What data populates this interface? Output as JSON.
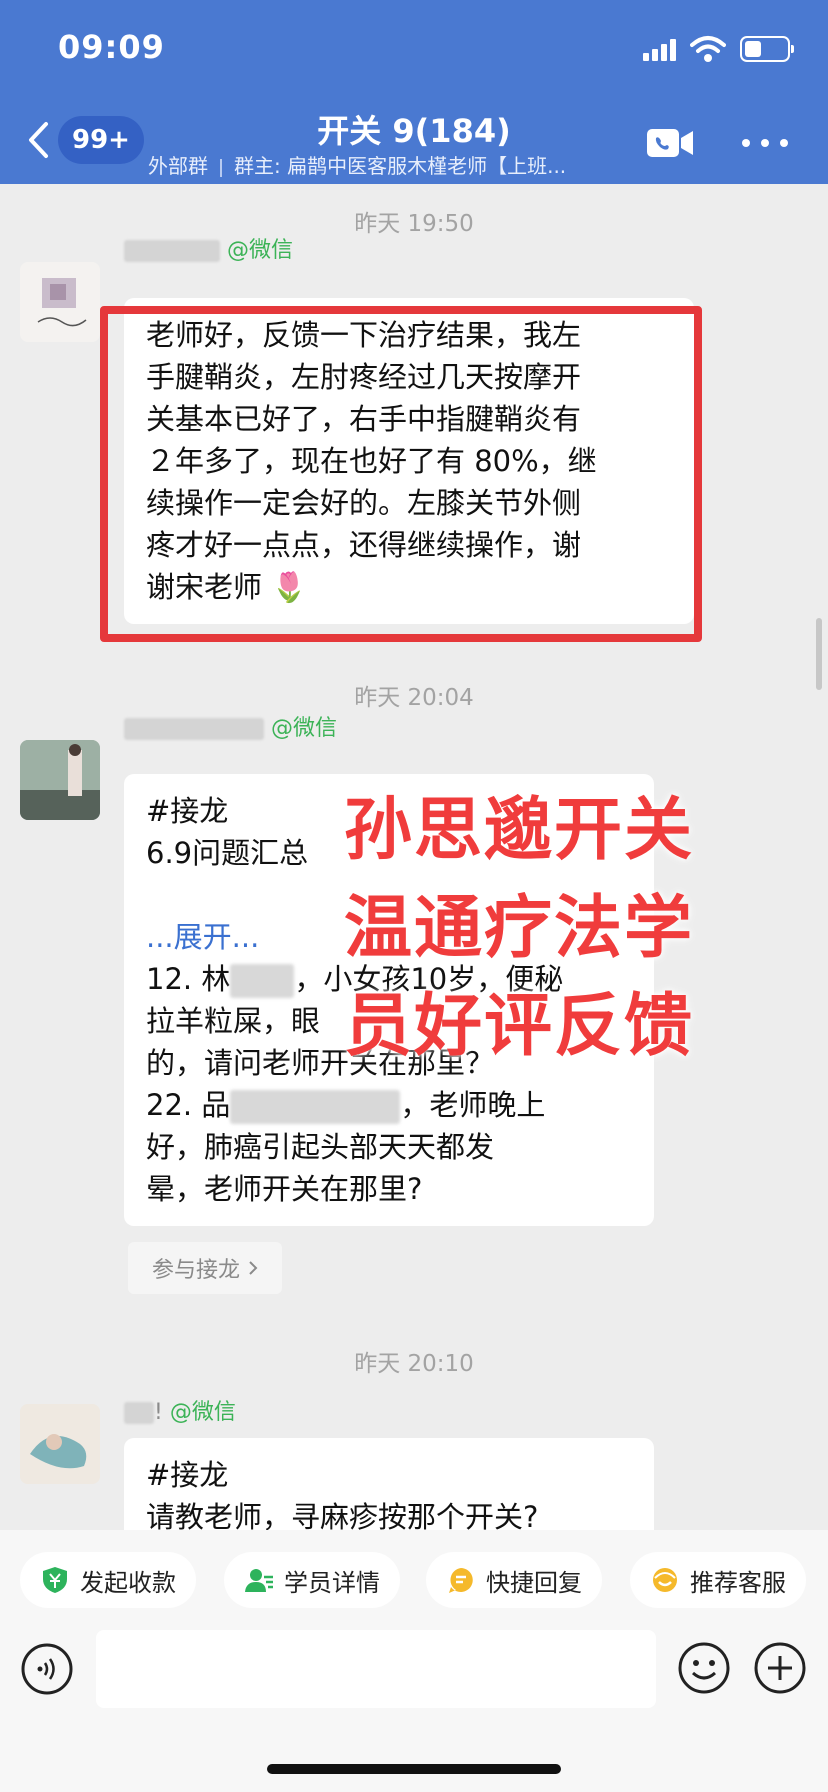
{
  "status_bar": {
    "time": "09:09"
  },
  "header": {
    "badge": "99+",
    "title": "开关 9(184)",
    "group_type": "外部群",
    "owner": "群主: 扁鹊中医客服木槿老师【上班..."
  },
  "messages": [
    {
      "timestamp": "昨天 19:50",
      "sender_suffix": "@微信",
      "lines": [
        "老师好，反馈一下治疗结果，我左",
        "手腱鞘炎，左肘疼经过几天按摩开",
        "关基本已好了，右手中指腱鞘炎有",
        "２年多了，现在也好了有 80%，继",
        "续操作一定会好的。左膝关节外侧",
        "疼才好一点点，还得继续操作，谢",
        "谢宋老师"
      ],
      "emoji": "🌷"
    },
    {
      "timestamp": "昨天 20:04",
      "sender_suffix": "@微信",
      "lines": [
        "#接龙",
        "6.9问题汇总",
        "",
        "...展开...",
        "12. 林",
        "拉羊粒屎，眼",
        "的，请问老师开关在那里？",
        "22. 品",
        "好，肺癌引起头部天天都发",
        "晕，老师开关在那里?"
      ],
      "line4_tail": "，小女孩10岁，便秘",
      "line7_tail": "，老师晚上",
      "join_label": "参与接龙"
    },
    {
      "timestamp": "昨天 20:10",
      "sender_suffix": "@微信",
      "sender_visible": "!",
      "lines": [
        "#接龙",
        "请教老师，寻麻疹按那个开关?"
      ]
    }
  ],
  "overlay_text": [
    "孙思邈开关",
    "温通疗法学",
    "员好评反馈"
  ],
  "quick_actions": [
    {
      "label": "发起收款",
      "icon": "payment-shield-icon",
      "color": "#2db35c"
    },
    {
      "label": "学员详情",
      "icon": "user-detail-icon",
      "color": "#2db35c"
    },
    {
      "label": "快捷回复",
      "icon": "quick-reply-icon",
      "color": "#f5b92b"
    },
    {
      "label": "推荐客服",
      "icon": "recommend-agent-icon",
      "color": "#f5b92b"
    }
  ],
  "colors": {
    "header": "#4a79d1",
    "highlight": "#e5383b",
    "overlay": "#f03c3c",
    "wechat": "#3cb357"
  }
}
